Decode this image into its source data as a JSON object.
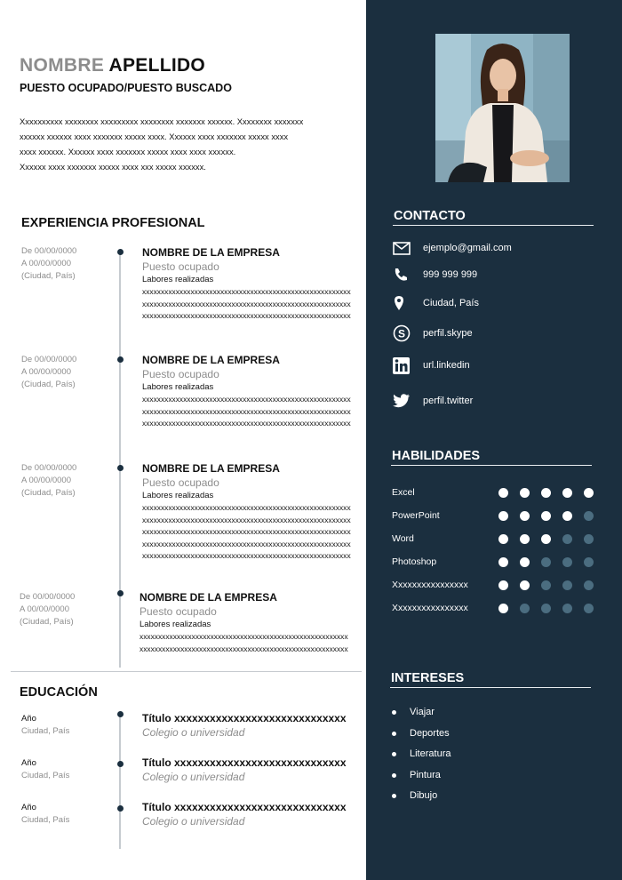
{
  "header": {
    "first_name": "NOMBRE",
    "last_name": "APELLIDO",
    "job_title": "PUESTO OCUPADO/PUESTO BUSCADO",
    "summary_lines": [
      "Xxxxxxxxxx xxxxxxxx xxxxxxxxx xxxxxxxx xxxxxxx xxxxxx. Xxxxxxxx xxxxxxx",
      "xxxxxx xxxxxx xxxx xxxxxxx xxxxx xxxx. Xxxxxx xxxx xxxxxxx xxxxx xxxx",
      "xxxx xxxxxx. Xxxxxx xxxx xxxxxxx xxxxx xxxx xxxx xxxxxx.",
      "Xxxxxx xxxx xxxxxxx xxxxx xxxx xxx xxxxx xxxxxx."
    ]
  },
  "experience": {
    "title": "EXPERIENCIA PROFESIONAL",
    "items": [
      {
        "date_from": "De 00/00/0000",
        "date_to": "A 00/00/0000",
        "location": "(Ciudad, País)",
        "company": "NOMBRE DE LA EMPRESA",
        "role": "Puesto ocupado",
        "tasks_label": "Labores realizadas",
        "lines": [
          "xxxxxxxxxxxxxxxxxxxxxxxxxxxxxxxxxxxxxxxxxxxxxxxxxxxxxxxxxxxxxxxxxx",
          "xxxxxxxxxxxxxxxxxxxxxxxxxxxxxxxxxxxxxxxxxxxxxxxxxxxxxxxxxxxxxxxxxx",
          "xxxxxxxxxxxxxxxxxxxxxxxxxxxxxxxxxxxxxxxxxxxxxxxxxxxxxxxxxxxxxxx"
        ]
      },
      {
        "date_from": "De 00/00/0000",
        "date_to": "A 00/00/0000",
        "location": "(Ciudad, País)",
        "company": "NOMBRE DE LA EMPRESA",
        "role": "Puesto ocupado",
        "tasks_label": "Labores realizadas",
        "lines": [
          "xxxxxxxxxxxxxxxxxxxxxxxxxxxxxxxxxxxxxxxxxxxxxxxxxxxxxxxxxxxxxxxxxx",
          "xxxxxxxxxxxxxxxxxxxxxxxxxxxxxxxxxxxxxxxxxxxxxxxxxxxxxxxxxxxxxxxxxx",
          "xxxxxxxxxxxxxxxxxxxxxxxxxxxxxxxxxxxxxxxxxxxxxxxxxxxxxxxxxxxxxxx"
        ]
      },
      {
        "date_from": "De 00/00/0000",
        "date_to": "A 00/00/0000",
        "location": "(Ciudad, País)",
        "company": "NOMBRE DE LA EMPRESA",
        "role": "Puesto ocupado",
        "tasks_label": "Labores realizadas",
        "lines": [
          "xxxxxxxxxxxxxxxxxxxxxxxxxxxxxxxxxxxxxxxxxxxxxxxxxxxxxxxxxxxxxxxxxx",
          "xxxxxxxxxxxxxxxxxxxxxxxxxxxxxxxxxxxxxxxxxxxxxxxxxxxxxxxxxxxxxxxxxx",
          "xxxxxxxxxxxxxxxxxxxxxxxxxxxxxxxxxxxxxxxxxxxxxxxxxxxxxxxxxxxxxxxxxx",
          "xxxxxxxxxxxxxxxxxxxxxxxxxxxxxxxxxxxxxxxxxxxxxxxxxxxxxxxxxxxxxxx",
          "xxxxxxxxxxxxxxxxxxxxxxxxxxxxxxxxxxxxxxxxxxxxxxxxxxxxxxxxxxxxxx"
        ]
      },
      {
        "date_from": "De 00/00/0000",
        "date_to": "A 00/00/0000",
        "location": "(Ciudad, País)",
        "company": "NOMBRE DE LA EMPRESA",
        "role": "Puesto ocupado",
        "tasks_label": "Labores realizadas",
        "lines": [
          "xxxxxxxxxxxxxxxxxxxxxxxxxxxxxxxxxxxxxxxxxxxxxxxxxxxxxxxxxxxxxxxxxx",
          "xxxxxxxxxxxxxxxxxxxxxxxxxxxxxxxxxxxxxxxxxxxxxxxxxxxxxxxxxxxxxxxx"
        ]
      }
    ]
  },
  "education": {
    "title": "EDUCACIÓN",
    "items": [
      {
        "year": "Año",
        "location": "Ciudad, País",
        "title": "Título xxxxxxxxxxxxxxxxxxxxxxxxxxxxx",
        "school": "Colegio o universidad"
      },
      {
        "year": "Año",
        "location": "Ciudad, País",
        "title": "Título xxxxxxxxxxxxxxxxxxxxxxxxxxxxx",
        "school": "Colegio o universidad"
      },
      {
        "year": "Año",
        "location": "Ciudad, País",
        "title": "Título xxxxxxxxxxxxxxxxxxxxxxxxxxxxx",
        "school": "Colegio o universidad"
      }
    ]
  },
  "contact": {
    "title": "CONTACTO",
    "items": [
      {
        "icon": "envelope-icon",
        "text": "ejemplo@gmail.com"
      },
      {
        "icon": "phone-icon",
        "text": "999 999 999"
      },
      {
        "icon": "location-pin-icon",
        "text": "Ciudad, País"
      },
      {
        "icon": "skype-icon",
        "text": "perfil.skype"
      },
      {
        "icon": "linkedin-icon",
        "text": "url.linkedin"
      },
      {
        "icon": "twitter-icon",
        "text": "perfil.twitter"
      }
    ]
  },
  "skills": {
    "title": "HABILIDADES",
    "max_level": 5,
    "items": [
      {
        "name": "Excel",
        "level": 5
      },
      {
        "name": "PowerPoint",
        "level": 4
      },
      {
        "name": "Word",
        "level": 3
      },
      {
        "name": "Photoshop",
        "level": 2
      },
      {
        "name": "Xxxxxxxxxxxxxxxx",
        "level": 2
      },
      {
        "name": "Xxxxxxxxxxxxxxxx",
        "level": 1
      }
    ]
  },
  "interests": {
    "title": "INTERESES",
    "items": [
      "Viajar",
      "Deportes",
      "Literatura",
      "Pintura",
      "Dibujo"
    ]
  },
  "colors": {
    "sidebar": "#1b2f3f",
    "muted_text": "#8d8d8d",
    "dot_on": "#ffffff",
    "dot_off": "#4b6d80"
  }
}
